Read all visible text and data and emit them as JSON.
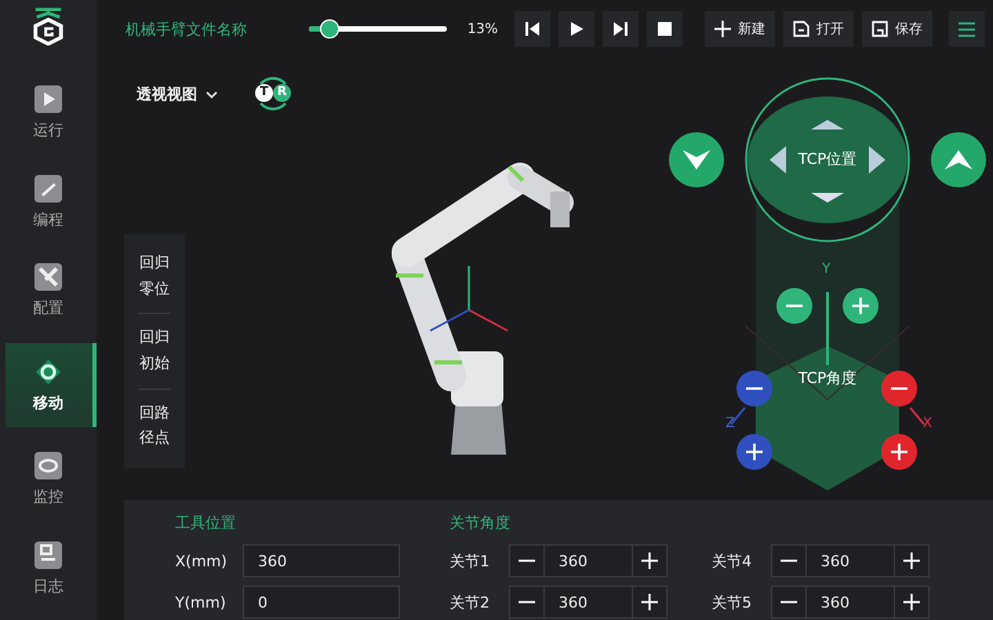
{
  "top_bar": {
    "file_name": "机械手臂文件名称",
    "speed": {
      "level": 0.13,
      "reading": "13%"
    },
    "media_buttons": [
      {
        "kind": "prev"
      },
      {
        "kind": "play"
      },
      {
        "kind": "next"
      },
      {
        "kind": "stop"
      }
    ],
    "actions": [
      {
        "kind": "new",
        "label": "新建"
      },
      {
        "kind": "open",
        "label": "打开"
      },
      {
        "kind": "save",
        "label": "保存"
      }
    ]
  },
  "sidebar": {
    "items": [
      {
        "kind": "run",
        "label": "运行",
        "selected": false
      },
      {
        "kind": "program",
        "label": "编程",
        "selected": false
      },
      {
        "kind": "config",
        "label": "配置",
        "selected": false
      },
      {
        "kind": "move",
        "label": "移动",
        "selected": true
      },
      {
        "kind": "monitor",
        "label": "监控",
        "selected": false
      },
      {
        "kind": "log",
        "label": "日志",
        "selected": false
      }
    ]
  },
  "view": {
    "dropdown": "透视视图",
    "toggle_letters": [
      "T",
      "R"
    ]
  },
  "home_menu": [
    "回归零位",
    "回归初始",
    "回路径点"
  ],
  "jog": {
    "position_label": "TCP位置",
    "angle_label": "TCP角度",
    "axes": [
      "Y",
      "Z",
      "X"
    ]
  },
  "bottom": {
    "tool_position": {
      "title": "工具位置",
      "fields": [
        {
          "label": "X(mm)",
          "value": "360"
        },
        {
          "label": "Y(mm)",
          "value": "0"
        }
      ]
    },
    "joint_angles": {
      "title": "关节角度",
      "joints": [
        {
          "label": "关节1",
          "value": "360"
        },
        {
          "label": "关节4",
          "value": "360"
        },
        {
          "label": "关节2",
          "value": "360"
        },
        {
          "label": "关节5",
          "value": "360"
        }
      ]
    }
  }
}
